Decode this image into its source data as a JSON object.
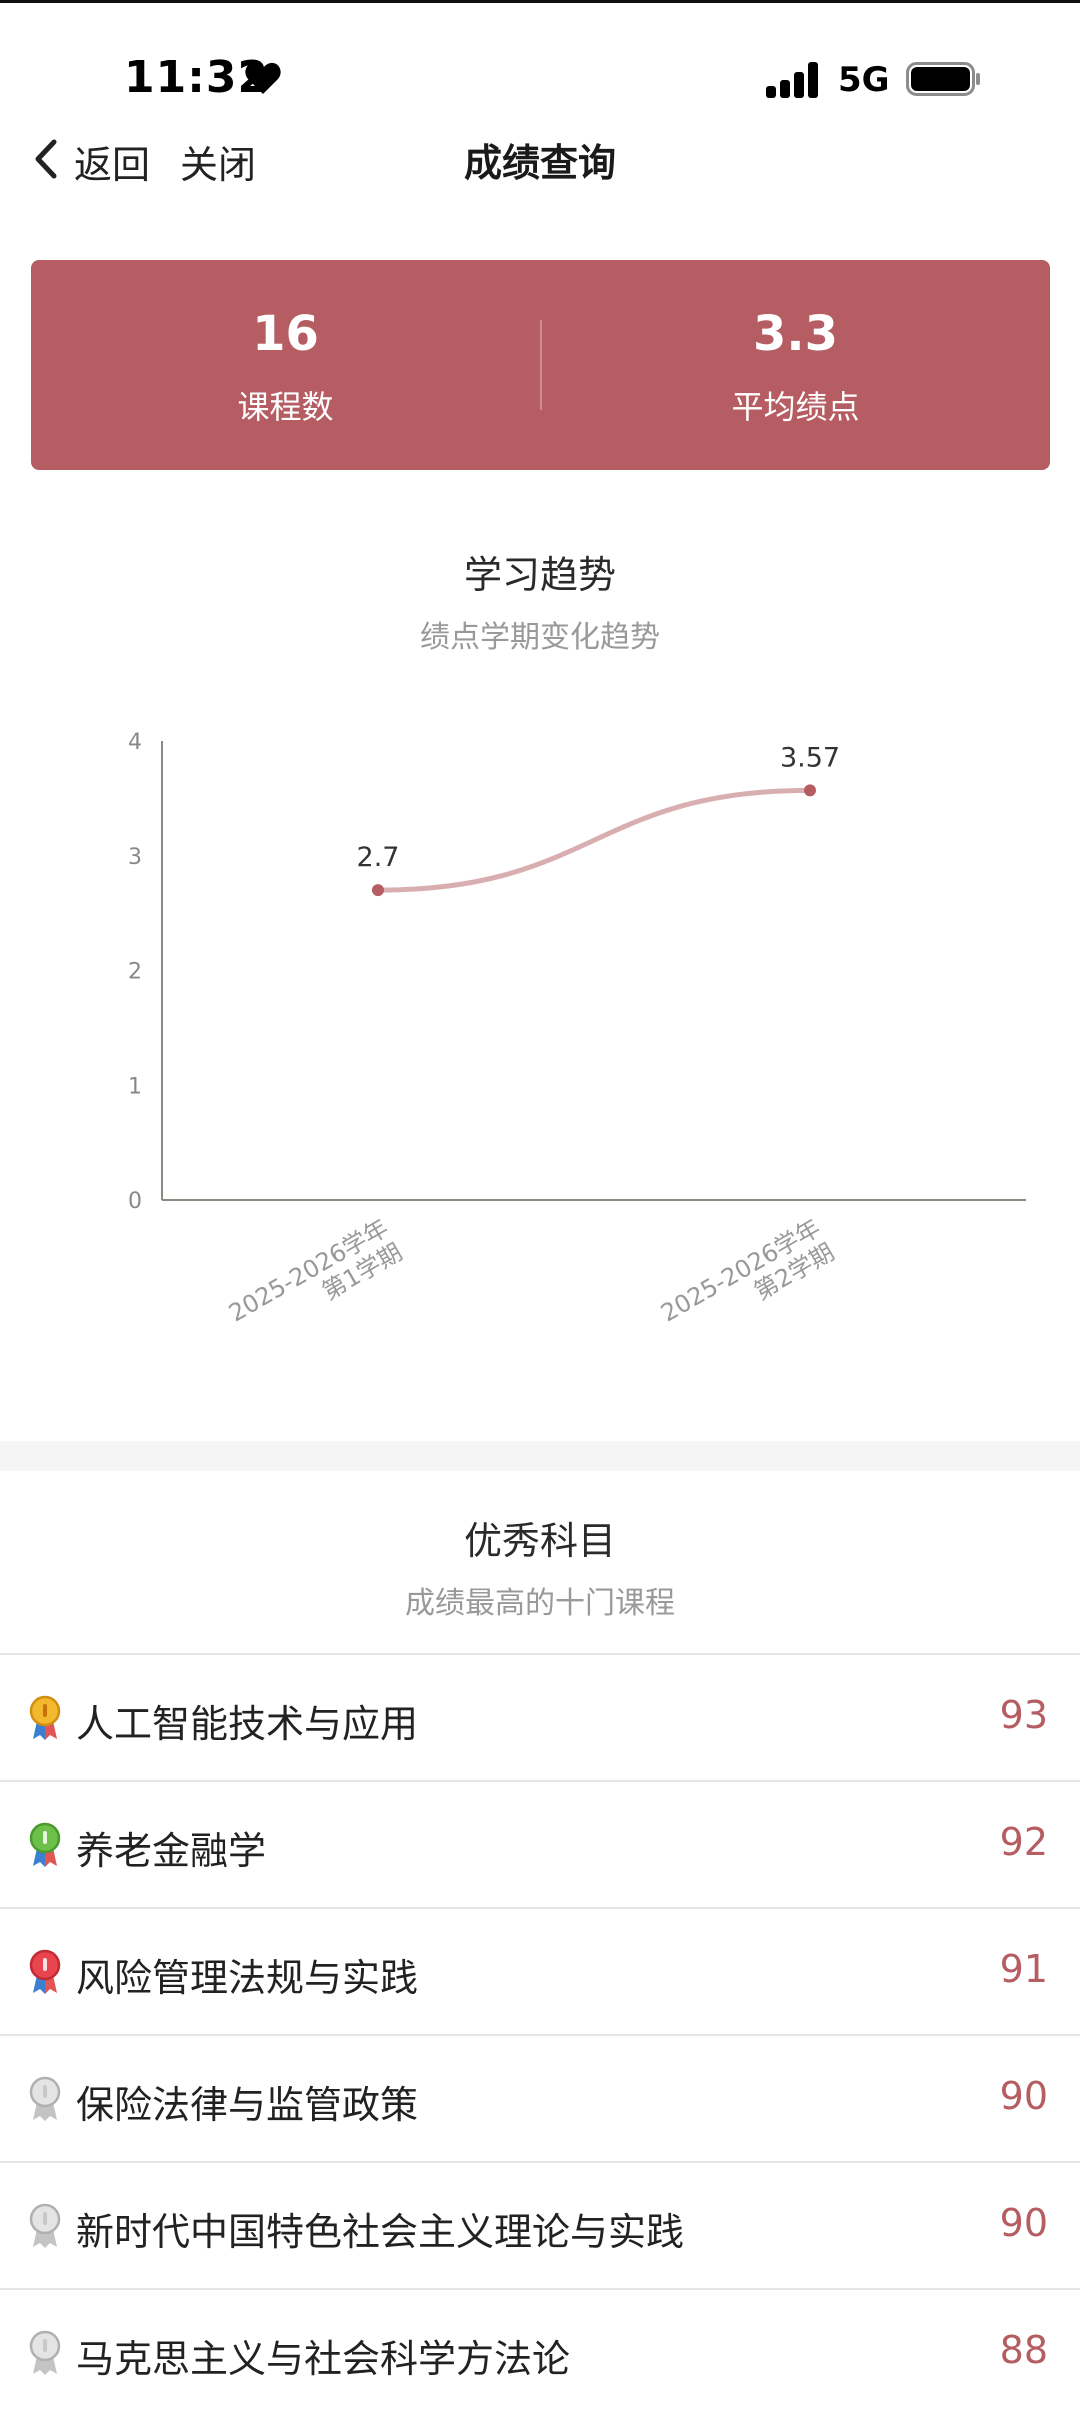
{
  "status_bar": {
    "time": "11:32",
    "network": "5G"
  },
  "nav": {
    "back_label": "返回",
    "close_label": "关闭",
    "title": "成绩查询"
  },
  "summary": {
    "courses_value": "16",
    "courses_label": "课程数",
    "gpa_value": "3.3",
    "gpa_label": "平均绩点",
    "accent_color": "#b55d62"
  },
  "trend": {
    "title": "学习趋势",
    "subtitle": "绩点学期变化趋势"
  },
  "chart_data": {
    "type": "line",
    "categories": [
      "2025-2026学年第1学期",
      "2025-2026学年第2学期"
    ],
    "tick_lines": [
      [
        "2025-2026学年",
        "第1学期"
      ],
      [
        "2025-2026学年",
        "第2学期"
      ]
    ],
    "values": [
      2.7,
      3.57
    ],
    "data_labels": [
      "2.7",
      "3.57"
    ],
    "ylim": [
      0,
      4
    ],
    "yticks": [
      "0",
      "1",
      "2",
      "3",
      "4"
    ],
    "xlabel": "",
    "ylabel": "",
    "line_color": "#d9aeb1",
    "point_color": "#b55d62",
    "smooth": true,
    "grid": false
  },
  "top_courses": {
    "title": "优秀科目",
    "subtitle": "成绩最高的十门课程",
    "items": [
      {
        "name": "人工智能技术与应用",
        "score": "93",
        "medal": "gold"
      },
      {
        "name": "养老金融学",
        "score": "92",
        "medal": "green"
      },
      {
        "name": "风险管理法规与实践",
        "score": "91",
        "medal": "red"
      },
      {
        "name": "保险法律与监管政策",
        "score": "90",
        "medal": "gray"
      },
      {
        "name": "新时代中国特色社会主义理论与实践",
        "score": "90",
        "medal": "gray"
      },
      {
        "name": "马克思主义与社会科学方法论",
        "score": "88",
        "medal": "gray"
      }
    ]
  }
}
